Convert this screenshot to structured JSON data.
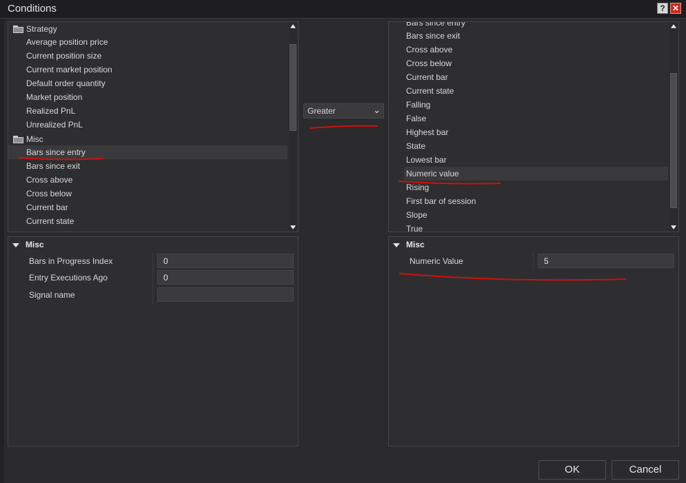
{
  "window": {
    "title": "Conditions",
    "help_label": "?",
    "close_label": "✕"
  },
  "left_tree": {
    "groups": [
      {
        "label": "Strategy",
        "items": [
          "Average position price",
          "Current position size",
          "Current market position",
          "Default order quantity",
          "Market position",
          "Realized PnL",
          "Unrealized PnL"
        ]
      },
      {
        "label": "Misc",
        "items": [
          "Bars since entry",
          "Bars since exit",
          "Cross above",
          "Cross below",
          "Current bar",
          "Current state"
        ]
      }
    ],
    "selected": "Bars since entry"
  },
  "operator": {
    "selected": "Greater"
  },
  "right_list": {
    "items": [
      "Bars since entry",
      "Bars since exit",
      "Cross above",
      "Cross below",
      "Current bar",
      "Current state",
      "Falling",
      "False",
      "Highest bar",
      "State",
      "Lowest bar",
      "Numeric value",
      "Rising",
      "First bar of session",
      "Slope",
      "True"
    ],
    "selected": "Numeric value"
  },
  "left_properties": {
    "category": "Misc",
    "rows": [
      {
        "label": "Bars in Progress Index",
        "value": "0"
      },
      {
        "label": "Entry Executions Ago",
        "value": "0"
      },
      {
        "label": "Signal name",
        "value": ""
      }
    ]
  },
  "right_properties": {
    "category": "Misc",
    "rows": [
      {
        "label": "Numeric Value",
        "value": "5"
      }
    ]
  },
  "footer": {
    "ok_label": "OK",
    "cancel_label": "Cancel"
  },
  "colors": {
    "background": "#2b2b2e",
    "panel": "#2e2e30",
    "annotation": "#d01010"
  },
  "icons": {
    "folder": "folder-icon",
    "collapse": "collapse-triangle-icon",
    "dropdown": "chevron-down-icon"
  }
}
